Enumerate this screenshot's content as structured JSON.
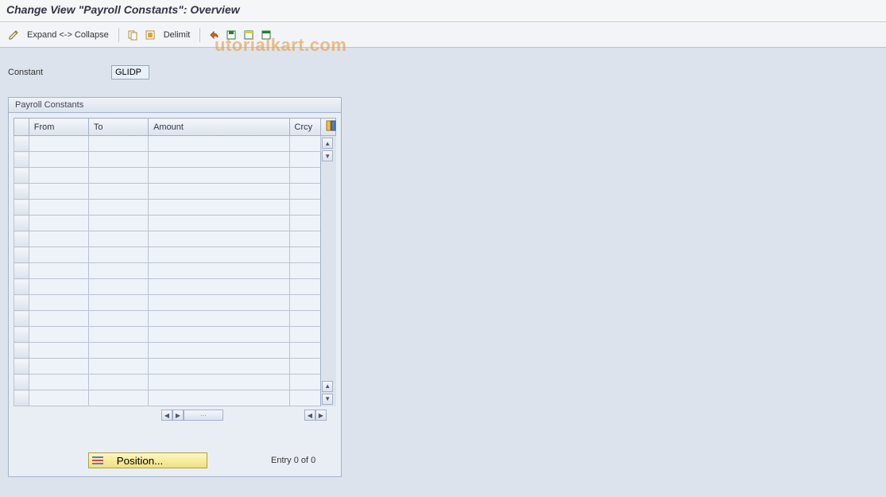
{
  "title": "Change View \"Payroll Constants\": Overview",
  "toolbar": {
    "expand_collapse": "Expand <-> Collapse",
    "delimit": "Delimit"
  },
  "field": {
    "constant_label": "Constant",
    "constant_value": "GLIDP"
  },
  "panel": {
    "title": "Payroll Constants",
    "columns": {
      "from": "From",
      "to": "To",
      "amount": "Amount",
      "crcy": "Crcy"
    }
  },
  "footer": {
    "position_label": "Position...",
    "entry_text": "Entry 0 of 0"
  },
  "watermark": "utorialkart.com"
}
